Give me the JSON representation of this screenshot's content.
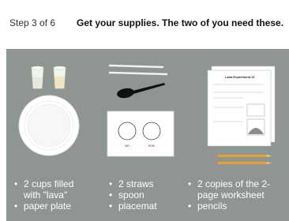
{
  "header": {
    "step_label": "Step 3 of 6",
    "title": "Get your supplies. The two of you need these."
  },
  "lists": {
    "left": [
      "2 cups filled with \"lava\"",
      "paper plate"
    ],
    "middle": [
      "2 straws",
      "spoon",
      "placemat"
    ],
    "right": [
      "2 copies of the 2-page worksheet",
      "pencils"
    ]
  },
  "placemat": {
    "left_label": "NO",
    "right_label": "SOK"
  },
  "worksheet": {
    "title": "Lava Experiment #1"
  },
  "colors": {
    "panel_bg": "#8f9591",
    "list_text": "#ffffff"
  }
}
